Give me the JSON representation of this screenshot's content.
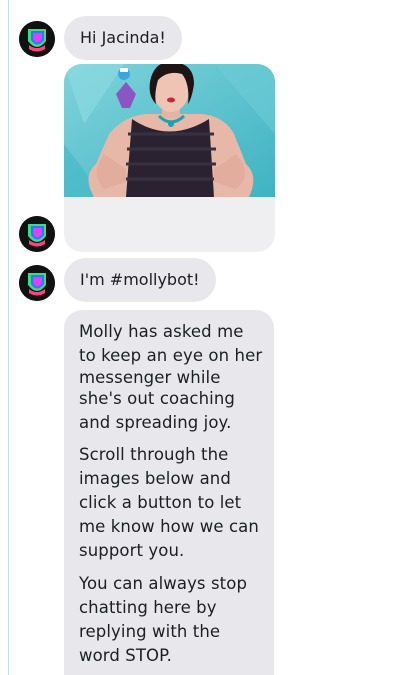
{
  "messages": {
    "greeting": "Hi Jacinda!",
    "intro": "I'm #mollybot!",
    "explain_p1": [
      "Molly has asked me",
      "to keep an eye on her",
      "messenger while",
      "she's out coaching",
      "and spreading joy."
    ],
    "explain_p2": [
      "Scroll through the",
      "images below and",
      "click a button to let",
      "me know how we can",
      "support you."
    ],
    "explain_p3": [
      "You can always stop",
      "chatting here by",
      "replying with the",
      "word STOP."
    ]
  },
  "photo": {
    "description_icon": "woman-portrait-photo"
  },
  "colors": {
    "bubble_bg": "#e8e8ec",
    "photo_bg": "#5cc3d0",
    "rule": "#bfe6e6"
  }
}
